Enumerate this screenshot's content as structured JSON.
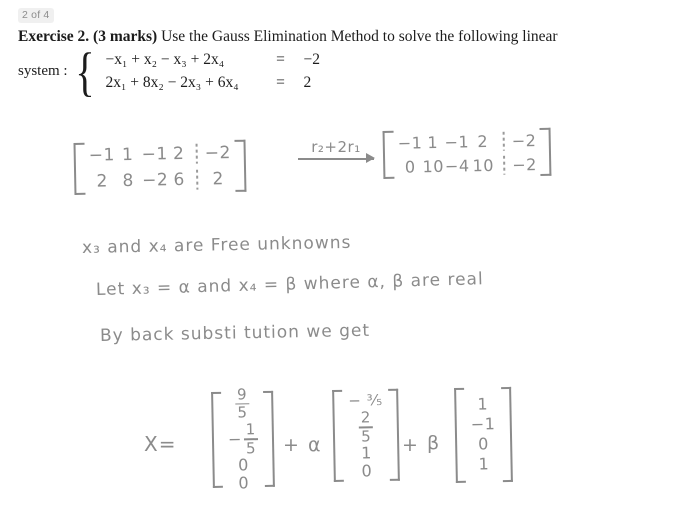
{
  "page": {
    "indicator": "2 of 4"
  },
  "exercise": {
    "label": "Exercise 2.",
    "marks": "(3 marks)",
    "prompt": "Use the Gauss Elimination Method to solve the following linear",
    "system_label": "system :",
    "equations": [
      {
        "lhs": "−x₁ + x₂ − x₃ + 2x₄",
        "eq": "=",
        "rhs": "−2"
      },
      {
        "lhs": "2x₁ + 8x₂ − 2x₃ + 6x₄",
        "eq": "=",
        "rhs": "2"
      }
    ]
  },
  "handwriting": {
    "matrix1": {
      "rows": [
        {
          "coeffs": [
            "−1",
            "1",
            "−1",
            "2"
          ],
          "rhs": "−2"
        },
        {
          "coeffs": [
            "2",
            "8",
            "−2",
            "6"
          ],
          "rhs": "2"
        }
      ]
    },
    "row_operation": "r₂+2r₁",
    "matrix2": {
      "rows": [
        {
          "coeffs": [
            "−1",
            "1",
            "−1",
            "2"
          ],
          "rhs": "−2"
        },
        {
          "coeffs": [
            "0",
            "10",
            "−4",
            "10"
          ],
          "rhs": "−2"
        }
      ]
    },
    "line_free": "x₃   and    x₄    are   Free   unknowns",
    "line_let": "Let       x₃ = α        and    x₄ = β       where   α, β   are  real",
    "line_backsub": "By    back     substi tution    we     get",
    "solution": {
      "x_label": "X=",
      "plus1": "+",
      "alpha": "α",
      "plus2": "+",
      "beta": "β",
      "particular": [
        "9/5",
        "-1/5",
        "0",
        "0"
      ],
      "alpha_vector": [
        "-3/5",
        "2/5",
        "1",
        "0"
      ],
      "beta_vector": [
        "1",
        "-1",
        "0",
        "1"
      ]
    }
  },
  "colors": {
    "background": "#ffffff",
    "print_ink": "#1c1c1c",
    "pencil_ink": "#8b8b8b",
    "badge_bg": "#f0f0f0",
    "badge_text": "#8c8c8c"
  }
}
